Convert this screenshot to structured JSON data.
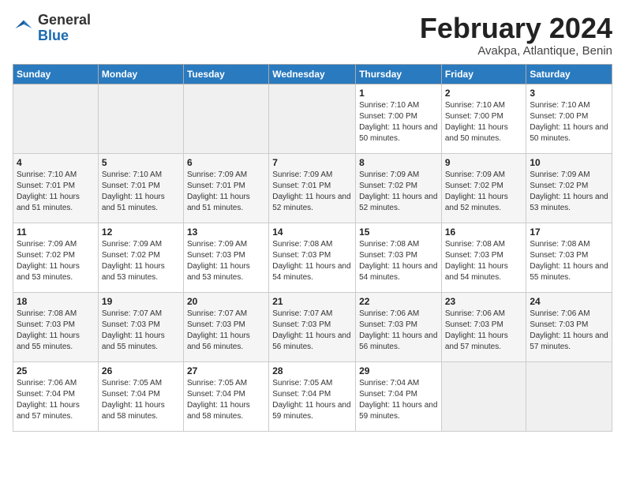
{
  "header": {
    "logo_general": "General",
    "logo_blue": "Blue",
    "month_year": "February 2024",
    "location": "Avakpa, Atlantique, Benin"
  },
  "days_of_week": [
    "Sunday",
    "Monday",
    "Tuesday",
    "Wednesday",
    "Thursday",
    "Friday",
    "Saturday"
  ],
  "weeks": [
    [
      {
        "day": "",
        "info": ""
      },
      {
        "day": "",
        "info": ""
      },
      {
        "day": "",
        "info": ""
      },
      {
        "day": "",
        "info": ""
      },
      {
        "day": "1",
        "info": "Sunrise: 7:10 AM\nSunset: 7:00 PM\nDaylight: 11 hours and 50 minutes."
      },
      {
        "day": "2",
        "info": "Sunrise: 7:10 AM\nSunset: 7:00 PM\nDaylight: 11 hours and 50 minutes."
      },
      {
        "day": "3",
        "info": "Sunrise: 7:10 AM\nSunset: 7:00 PM\nDaylight: 11 hours and 50 minutes."
      }
    ],
    [
      {
        "day": "4",
        "info": "Sunrise: 7:10 AM\nSunset: 7:01 PM\nDaylight: 11 hours and 51 minutes."
      },
      {
        "day": "5",
        "info": "Sunrise: 7:10 AM\nSunset: 7:01 PM\nDaylight: 11 hours and 51 minutes."
      },
      {
        "day": "6",
        "info": "Sunrise: 7:09 AM\nSunset: 7:01 PM\nDaylight: 11 hours and 51 minutes."
      },
      {
        "day": "7",
        "info": "Sunrise: 7:09 AM\nSunset: 7:01 PM\nDaylight: 11 hours and 52 minutes."
      },
      {
        "day": "8",
        "info": "Sunrise: 7:09 AM\nSunset: 7:02 PM\nDaylight: 11 hours and 52 minutes."
      },
      {
        "day": "9",
        "info": "Sunrise: 7:09 AM\nSunset: 7:02 PM\nDaylight: 11 hours and 52 minutes."
      },
      {
        "day": "10",
        "info": "Sunrise: 7:09 AM\nSunset: 7:02 PM\nDaylight: 11 hours and 53 minutes."
      }
    ],
    [
      {
        "day": "11",
        "info": "Sunrise: 7:09 AM\nSunset: 7:02 PM\nDaylight: 11 hours and 53 minutes."
      },
      {
        "day": "12",
        "info": "Sunrise: 7:09 AM\nSunset: 7:02 PM\nDaylight: 11 hours and 53 minutes."
      },
      {
        "day": "13",
        "info": "Sunrise: 7:09 AM\nSunset: 7:03 PM\nDaylight: 11 hours and 53 minutes."
      },
      {
        "day": "14",
        "info": "Sunrise: 7:08 AM\nSunset: 7:03 PM\nDaylight: 11 hours and 54 minutes."
      },
      {
        "day": "15",
        "info": "Sunrise: 7:08 AM\nSunset: 7:03 PM\nDaylight: 11 hours and 54 minutes."
      },
      {
        "day": "16",
        "info": "Sunrise: 7:08 AM\nSunset: 7:03 PM\nDaylight: 11 hours and 54 minutes."
      },
      {
        "day": "17",
        "info": "Sunrise: 7:08 AM\nSunset: 7:03 PM\nDaylight: 11 hours and 55 minutes."
      }
    ],
    [
      {
        "day": "18",
        "info": "Sunrise: 7:08 AM\nSunset: 7:03 PM\nDaylight: 11 hours and 55 minutes."
      },
      {
        "day": "19",
        "info": "Sunrise: 7:07 AM\nSunset: 7:03 PM\nDaylight: 11 hours and 55 minutes."
      },
      {
        "day": "20",
        "info": "Sunrise: 7:07 AM\nSunset: 7:03 PM\nDaylight: 11 hours and 56 minutes."
      },
      {
        "day": "21",
        "info": "Sunrise: 7:07 AM\nSunset: 7:03 PM\nDaylight: 11 hours and 56 minutes."
      },
      {
        "day": "22",
        "info": "Sunrise: 7:06 AM\nSunset: 7:03 PM\nDaylight: 11 hours and 56 minutes."
      },
      {
        "day": "23",
        "info": "Sunrise: 7:06 AM\nSunset: 7:03 PM\nDaylight: 11 hours and 57 minutes."
      },
      {
        "day": "24",
        "info": "Sunrise: 7:06 AM\nSunset: 7:03 PM\nDaylight: 11 hours and 57 minutes."
      }
    ],
    [
      {
        "day": "25",
        "info": "Sunrise: 7:06 AM\nSunset: 7:04 PM\nDaylight: 11 hours and 57 minutes."
      },
      {
        "day": "26",
        "info": "Sunrise: 7:05 AM\nSunset: 7:04 PM\nDaylight: 11 hours and 58 minutes."
      },
      {
        "day": "27",
        "info": "Sunrise: 7:05 AM\nSunset: 7:04 PM\nDaylight: 11 hours and 58 minutes."
      },
      {
        "day": "28",
        "info": "Sunrise: 7:05 AM\nSunset: 7:04 PM\nDaylight: 11 hours and 59 minutes."
      },
      {
        "day": "29",
        "info": "Sunrise: 7:04 AM\nSunset: 7:04 PM\nDaylight: 11 hours and 59 minutes."
      },
      {
        "day": "",
        "info": ""
      },
      {
        "day": "",
        "info": ""
      }
    ]
  ]
}
